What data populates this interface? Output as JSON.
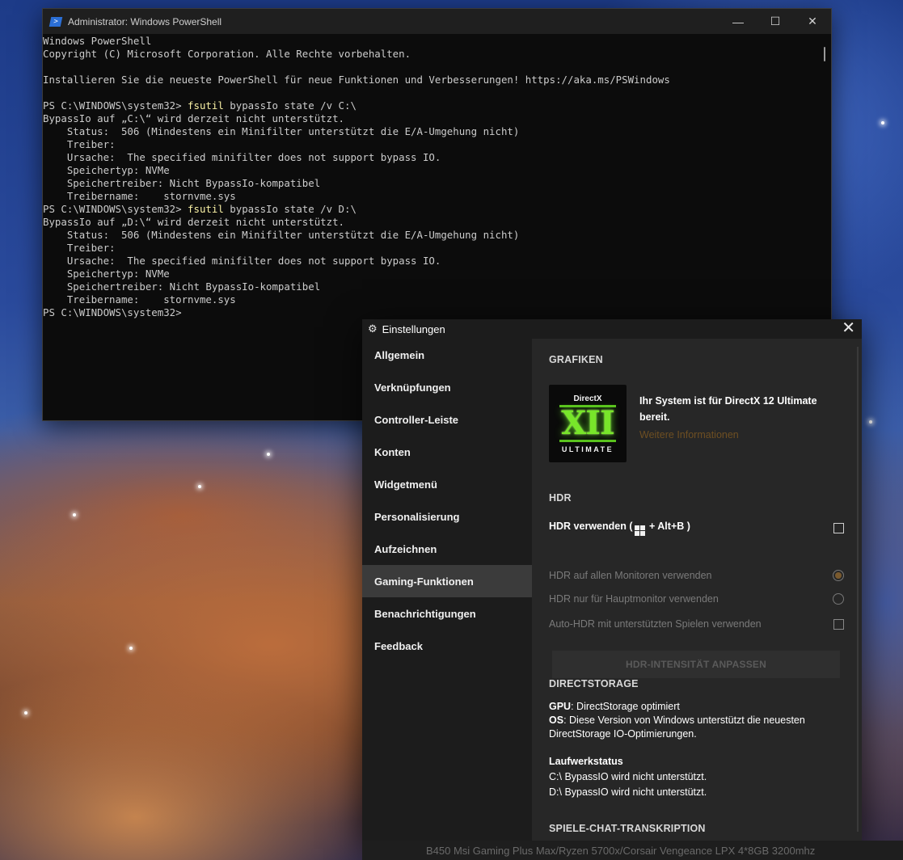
{
  "powershell": {
    "title": "Administrator: Windows PowerShell",
    "icon": "powershell-icon",
    "controls": {
      "minimize": "—",
      "maximize": "☐",
      "close": "✕"
    },
    "lines": [
      {
        "text": "Windows PowerShell"
      },
      {
        "text": "Copyright (C) Microsoft Corporation. Alle Rechte vorbehalten."
      },
      {
        "text": ""
      },
      {
        "text": "Installieren Sie die neueste PowerShell für neue Funktionen und Verbesserungen! https://aka.ms/PSWindows"
      },
      {
        "text": ""
      },
      {
        "prompt": "PS C:\\WINDOWS\\system32> ",
        "cmd": "fsutil",
        "rest": " bypassIo state /v C:\\"
      },
      {
        "text": "BypassIo auf „C:\\“ wird derzeit nicht unterstützt."
      },
      {
        "text": "    Status:  506 (Mindestens ein Minifilter unterstützt die E/A-Umgehung nicht)"
      },
      {
        "text": "    Treiber:"
      },
      {
        "text": "    Ursache:  The specified minifilter does not support bypass IO."
      },
      {
        "text": "    Speichertyp: NVMe"
      },
      {
        "text": "    Speichertreiber: Nicht BypassIo-kompatibel"
      },
      {
        "text": "    Treibername:    stornvme.sys"
      },
      {
        "prompt": "PS C:\\WINDOWS\\system32> ",
        "cmd": "fsutil",
        "rest": " bypassIo state /v D:\\"
      },
      {
        "text": "BypassIo auf „D:\\“ wird derzeit nicht unterstützt."
      },
      {
        "text": "    Status:  506 (Mindestens ein Minifilter unterstützt die E/A-Umgehung nicht)"
      },
      {
        "text": "    Treiber:"
      },
      {
        "text": "    Ursache:  The specified minifilter does not support bypass IO."
      },
      {
        "text": "    Speichertyp: NVMe"
      },
      {
        "text": "    Speichertreiber: Nicht BypassIo-kompatibel"
      },
      {
        "text": "    Treibername:    stornvme.sys"
      },
      {
        "text": "PS C:\\WINDOWS\\system32>"
      }
    ],
    "colors": {
      "command": "#f9f1a5",
      "text": "#cccccc",
      "background": "#0c0c0c"
    }
  },
  "settings": {
    "title": "Einstellungen",
    "close": "✕",
    "nav": [
      "Allgemein",
      "Verknüpfungen",
      "Controller-Leiste",
      "Konten",
      "Widgetmenü",
      "Personalisierung",
      "Aufzeichnen",
      "Gaming-Funktionen",
      "Benachrichtigungen",
      "Feedback"
    ],
    "active_nav": "Gaming-Funktionen",
    "grafiken": {
      "heading": "GRAFIKEN",
      "logo_top": "DirectX",
      "logo_mid": "XII",
      "logo_bottom": "ULTIMATE",
      "status": "Ihr System ist für DirectX 12 Ultimate bereit.",
      "link": "Weitere Informationen"
    },
    "hdr": {
      "heading": "HDR",
      "use_hdr_prefix": "HDR verwenden (",
      "use_hdr_suffix": " + Alt+B )",
      "all_monitors": "HDR auf allen Monitoren verwenden",
      "main_monitor": "HDR nur für Hauptmonitor verwenden",
      "auto_hdr": "Auto-HDR mit unterstützten Spielen verwenden",
      "intensity_button": "HDR-INTENSITÄT ANPASSEN",
      "use_hdr_checked": false,
      "all_monitors_selected": true,
      "main_monitor_selected": false,
      "auto_hdr_checked": false
    },
    "directstorage": {
      "heading": "DIRECTSTORAGE",
      "gpu_label": "GPU",
      "gpu_value": ": DirectStorage optimiert",
      "os_label": "OS",
      "os_value": ": Diese Version von Windows unterstützt die neuesten DirectStorage IO-Optimierungen.",
      "drive_heading": "Laufwerkstatus",
      "drive_c": "C:\\ BypassIO wird nicht unterstützt.",
      "drive_d": "D:\\ BypassIO wird nicht unterstützt."
    },
    "chat": {
      "heading": "SPIELE-CHAT-TRANSKRIPTION"
    }
  },
  "background_strip": {
    "text": "B450 Msi Gaming Plus Max/Ryzen 5700x/Corsair Vengeance LPX 4*8GB 3200mhz"
  }
}
